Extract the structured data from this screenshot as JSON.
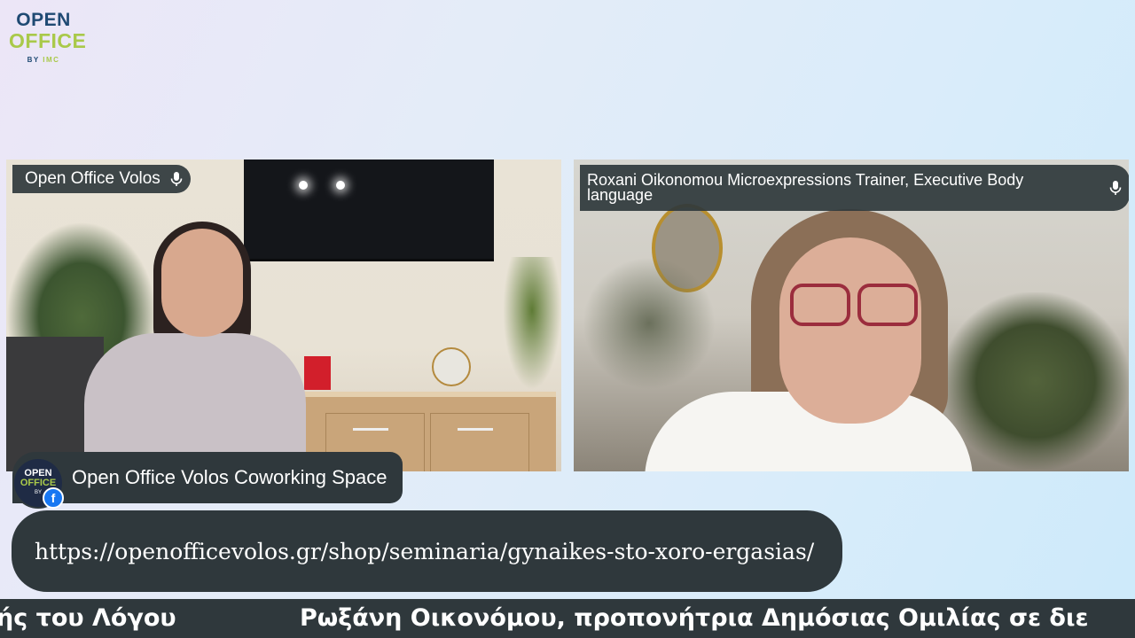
{
  "logo": {
    "line1": "OPEN",
    "line2": "OFFICE",
    "by": "BY",
    "imc": "IMC"
  },
  "participants": [
    {
      "name": "Open Office Volos",
      "mic_icon": "microphone-icon"
    },
    {
      "name": "Roxani Oikonomou Microexpressions Trainer, Executive Body language",
      "mic_icon": "microphone-icon"
    }
  ],
  "banner": {
    "badge_line1": "OPEN",
    "badge_line2": "OFFICE",
    "badge_line3": "BY",
    "facebook_glyph": "f",
    "title": "Open Office Volos Coworking Space"
  },
  "url_text": "https://openofficevolos.gr/shop/seminaria/gynaikes-sto-xoro-ergasias/",
  "ticker": {
    "segment1": "ής του Λόγου",
    "segment2": "Ρωξάνη Οικονόμου, προπονήτρια Δημόσιας Ομιλίας σε διε"
  },
  "colors": {
    "bar_bg": "#2f383c",
    "logo_blue": "#1f4a73",
    "logo_green": "#a9c94a",
    "facebook": "#1877f2"
  }
}
